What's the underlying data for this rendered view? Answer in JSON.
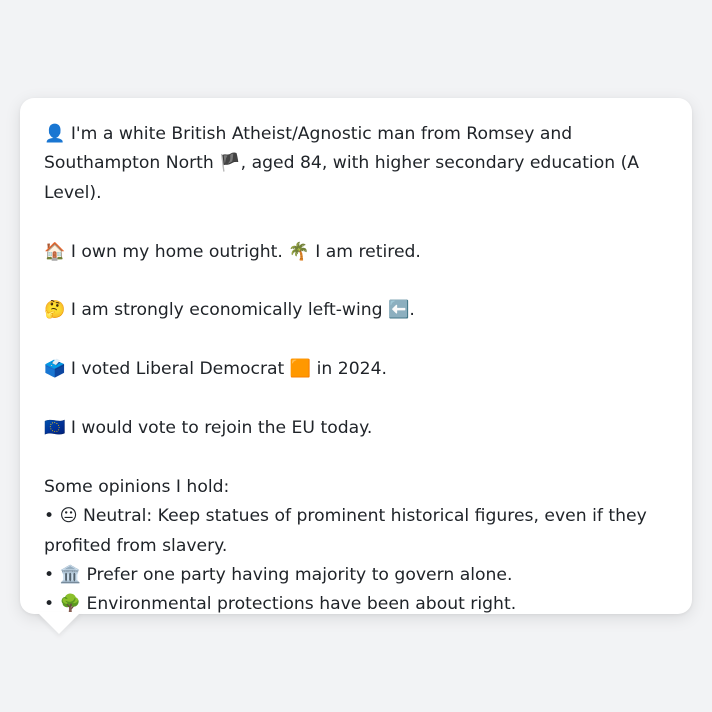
{
  "profile": {
    "intro": "👤 I'm a white British Atheist/Agnostic man from Romsey and Southampton North 🏴, aged 84, with higher secondary education (A Level).",
    "home": "🏠 I own my home outright. 🌴 I am retired.",
    "economics": "🤔 I am strongly economically left-wing ⬅️.",
    "vote": "🗳️ I voted Liberal Democrat 🟧 in 2024.",
    "eu": "🇪🇺 I would vote to rejoin the EU today.",
    "opinions_heading": "Some opinions I hold:",
    "opinions": [
      "• 😐 Neutral: Keep statues of prominent historical figures, even if they profited from slavery.",
      "• 🏛️ Prefer one party having majority to govern alone.",
      "• 🌳 Environmental protections have been about right."
    ]
  }
}
